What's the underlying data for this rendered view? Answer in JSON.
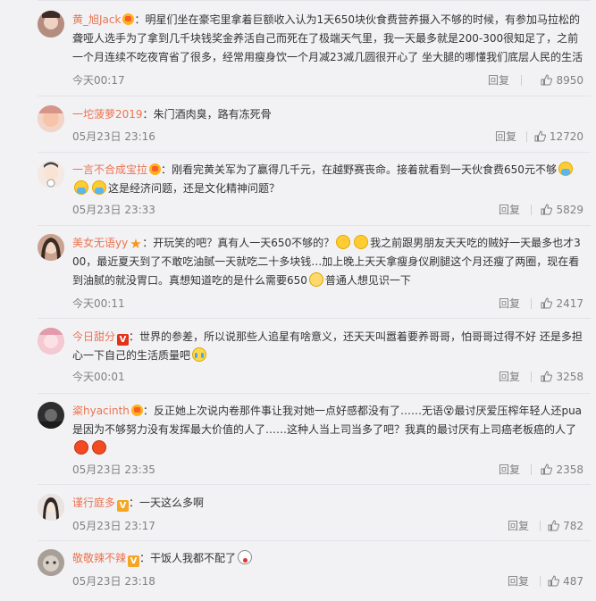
{
  "reply_label": "回复",
  "comments": [
    {
      "user": "黄_旭Jack",
      "segments": [
        "明星们坐在豪宅里拿着巨额收入认为1天650块伙食费营养摄入不够的时候，有参加马拉松的聋哑人选手为了拿到几千块钱奖金养活自己而死在了极端天气里，我一天最多就是200-300很知足了，之前一个月连续不吃夜宵省了很多，经常用瘦身饮一个月减23减几圆很开心了 坐大腿的哪懂我们底层人民的生活"
      ],
      "time": "今天00:17",
      "likes": "8950"
    },
    {
      "user": "一坨菠萝2019",
      "segments": [
        "朱门酒肉臭，路有冻死骨"
      ],
      "time": "05月23日 23:16",
      "likes": "12720"
    },
    {
      "user": "一言不合成宝拉",
      "segments": [
        "刚看完黄关军为了赢得几千元，在越野赛丧命。接着就看到一天伙食费650元不够",
        "这是经济问题，还是文化精神问题？"
      ],
      "time": "05月23日 23:33",
      "likes": "5829"
    },
    {
      "user": "美女无语yy",
      "segments": [
        "开玩笑的吧？真有人一天650不够的？",
        "我之前跟男朋友天天吃的贼好一天最多也才300，最近夏天到了不敢吃油腻一天就吃二十多块钱…加上晚上天天拿瘦身仪刷腿这个月还瘦了两圈，现在看到油腻的就没胃口。真想知道吃的是什么需要650",
        "普通人想见识一下"
      ],
      "time": "今天00:11",
      "likes": "2417"
    },
    {
      "user": "今日甜分",
      "segments": [
        "世界的参差，所以说那些人追星有啥意义，还天天叫嚣着要养哥哥，怕哥哥过得不好 还是多担心一下自己的生活质量吧"
      ],
      "time": "今天00:01",
      "likes": "3258"
    },
    {
      "user": "粢hyacinth",
      "segments": [
        "反正她上次说内卷那件事让我对她一点好感都没有了……无语😵最讨厌爱压榨年轻人还pua是因为不够努力没有发挥最大价值的人了……这种人当上司当多了吧？我真的最讨厌有上司癌老板癌的人了"
      ],
      "time": "05月23日 23:35",
      "likes": "2358"
    },
    {
      "user": "谨行庭多",
      "segments": [
        "一天这么多啊"
      ],
      "time": "05月23日 23:17",
      "likes": "782"
    },
    {
      "user": "敬敬辣不辣",
      "segments": [
        "干饭人我都不配了"
      ],
      "time": "05月23日 23:18",
      "likes": "487"
    }
  ]
}
